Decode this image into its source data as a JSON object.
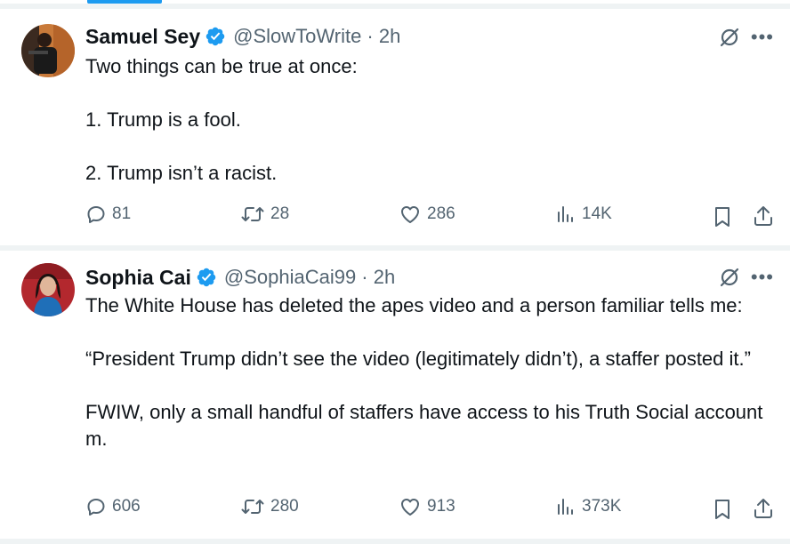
{
  "tweets": [
    {
      "author_name": "Samuel Sey",
      "handle_time": "@SlowToWrite · 2h",
      "lines": [
        "Two things can be true at once:",
        "1. Trump is a fool.",
        "2. Trump isn’t a racist."
      ],
      "stats": {
        "replies": "81",
        "reposts": "28",
        "likes": "286",
        "views": "14K"
      }
    },
    {
      "author_name": "Sophia Cai",
      "handle_time": "@SophiaCai99 · 2h",
      "lines": [
        "The White House has deleted the apes video and a person familiar tells me:",
        "“President Trump didn’t see the video (legitimately didn’t), a staffer posted it.”",
        "FWIW, only a small handful of staffers have access to his Truth Social account m."
      ],
      "stats": {
        "replies": "606",
        "reposts": "280",
        "likes": "913",
        "views": "373K"
      }
    }
  ],
  "icons": {
    "verified": "verified-badge-icon",
    "grok": "grok-icon",
    "more": "more-icon",
    "reply": "reply-icon",
    "repost": "repost-icon",
    "like": "like-icon",
    "views": "views-icon",
    "bookmark": "bookmark-icon",
    "share": "share-icon"
  },
  "colors": {
    "accent": "#1d9bf0",
    "secondary_text": "#536471",
    "divider": "#eff3f4"
  }
}
